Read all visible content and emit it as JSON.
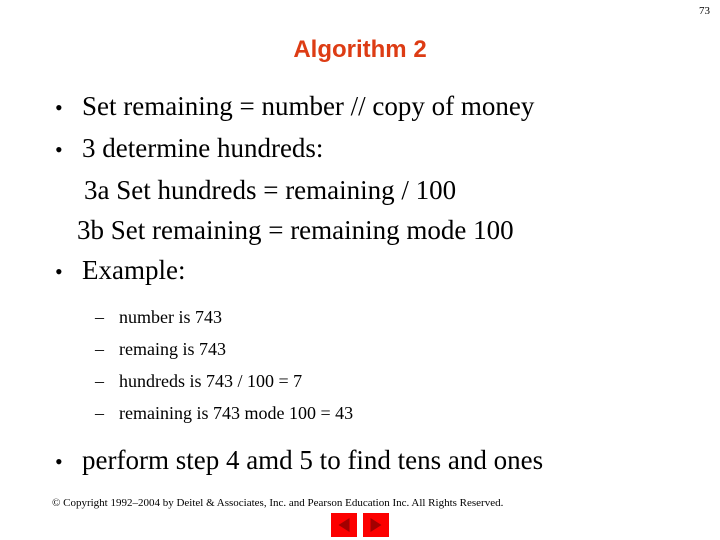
{
  "slide": {
    "page_number": "73",
    "title": "Algorithm 2",
    "title_color": "#dd3c14",
    "background_color": "#ffffff",
    "text_color": "#000000"
  },
  "body": {
    "bullet_glyph": "•",
    "dash_glyph": "–",
    "items": [
      {
        "level": 1,
        "text": "Set remaining = number // copy of money"
      },
      {
        "level": 1,
        "text": "3 determine hundreds:"
      },
      {
        "level": 0,
        "text": "3a Set hundreds = remaining / 100"
      },
      {
        "level": 0,
        "text": "3b Set remaining = remaining mode 100"
      },
      {
        "level": 1,
        "text": "Example:"
      },
      {
        "level": 2,
        "text": "number is 743"
      },
      {
        "level": 2,
        "text": "remaing is 743"
      },
      {
        "level": 2,
        "text": "hundreds is 743 / 100 = 7"
      },
      {
        "level": 2,
        "text": "remaining is 743 mode 100 = 43"
      },
      {
        "level": 1,
        "text": "perform step 4 amd 5 to find tens and ones"
      }
    ]
  },
  "footer": {
    "copyright": "© Copyright 1992–2004 by Deitel & Associates, Inc. and Pearson Education Inc. All Rights Reserved.",
    "nav": {
      "prev_label": "Previous slide",
      "next_label": "Next slide",
      "button_color": "#fc0000",
      "arrow_color": "#a30000"
    }
  }
}
